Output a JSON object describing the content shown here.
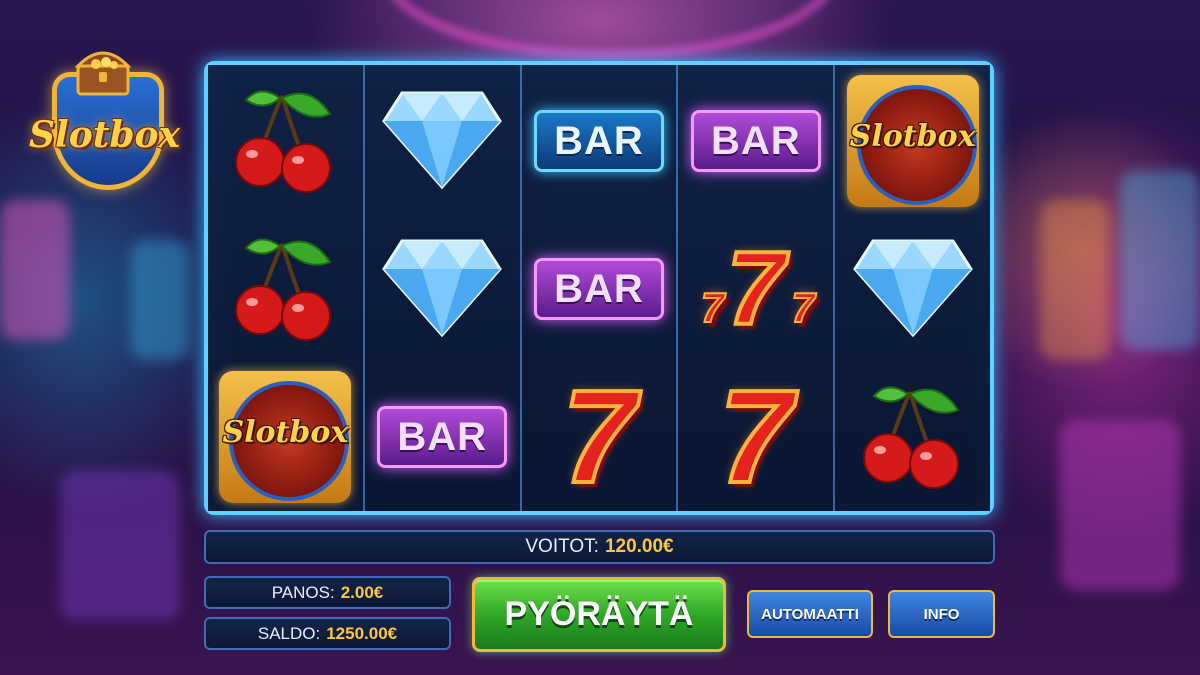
{
  "brand": {
    "logo_text": "Slotbox"
  },
  "reels": [
    [
      "cherry",
      "cherry",
      "slotbox"
    ],
    [
      "diamond",
      "diamond",
      "bar-purple"
    ],
    [
      "bar-blue",
      "bar-purple",
      "seven"
    ],
    [
      "bar-purple",
      "seven-triple",
      "seven"
    ],
    [
      "slotbox",
      "diamond",
      "cherry"
    ]
  ],
  "symbol_text": {
    "bar": "BAR",
    "seven": "7",
    "emblem": "Slotbox"
  },
  "status": {
    "win_label": "VOITOT:",
    "win_value": "120.00€",
    "bet_label": "PANOS:",
    "bet_value": "2.00€",
    "balance_label": "SALDO:",
    "balance_value": "1250.00€"
  },
  "controls": {
    "spin_label": "PYÖRÄYTÄ",
    "auto_label": "AUTOMAATTI",
    "info_label": "INFO"
  },
  "colors": {
    "frame": "#5fd0ff",
    "accent_gold": "#ffc83a",
    "spin_green": "#2fa828"
  }
}
